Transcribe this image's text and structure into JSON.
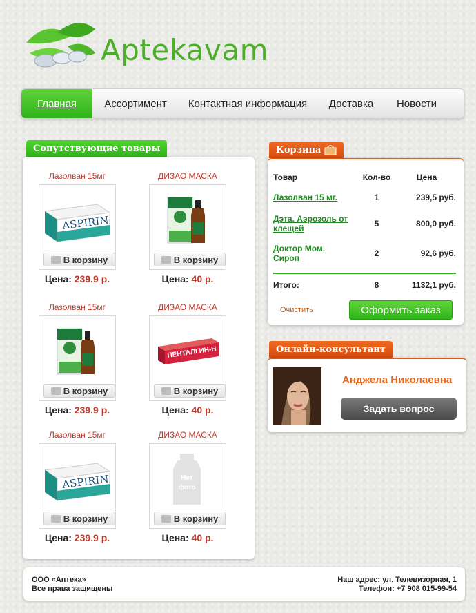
{
  "logo": {
    "text": "Aptekavam"
  },
  "nav": {
    "items": [
      "Главная",
      "Ассортимент",
      "Контактная информация",
      "Доставка",
      "Новости"
    ],
    "active": "Главная"
  },
  "related": {
    "title": "Сопутствующие товары",
    "cart_label": "В корзину",
    "price_label": "Цена:",
    "products": [
      {
        "name": "Лазолван 15мг",
        "price": "239.9 р.",
        "image": "aspirin-box"
      },
      {
        "name": "ДИЗАО МАСКА",
        "price": "40 р.",
        "image": "syrup-bottles"
      },
      {
        "name": "Лазолван 15мг",
        "price": "239.9 р.",
        "image": "syrup-bottles"
      },
      {
        "name": "ДИЗАО МАСКА",
        "price": "40 р.",
        "image": "pentalgin-box"
      },
      {
        "name": "Лазолван 15мг",
        "price": "239.9 р.",
        "image": "aspirin-box"
      },
      {
        "name": "ДИЗАО МАСКА",
        "price": "40 р.",
        "image": "no-photo"
      }
    ]
  },
  "basket": {
    "title": "Корзина",
    "headers": [
      "Товар",
      "Кол-во",
      "Цена"
    ],
    "rows": [
      {
        "name": "Лазолван 15 мг.",
        "qty": "1",
        "price": "239,5 руб."
      },
      {
        "name": "Дэта. Аэрозоль от клещей",
        "qty": "5",
        "price": "800,0 руб."
      },
      {
        "name": "Доктор Мом. Сироп",
        "qty": "2",
        "price": "92,6 руб."
      }
    ],
    "total_label": "Итого:",
    "total_qty": "8",
    "total_price": "1132,1 руб.",
    "clear_label": "Очистить",
    "order_label": "Оформить заказ"
  },
  "consultant": {
    "title": "Онлайн-консультант",
    "name": "Анджела Николаевна",
    "ask_label": "Задать вопрос"
  },
  "footer": {
    "company": "ООО «Аптека»",
    "rights": "Все права защищены",
    "address": "Наш адрес: ул. Телевизорная, 1",
    "phone": "Телефон: +7 908 015-99-54"
  },
  "misc": {
    "no_photo_text": "Нет фото"
  },
  "colors": {
    "green": "#2fb31a",
    "orange": "#e8671e",
    "price_red": "#c0392b"
  }
}
